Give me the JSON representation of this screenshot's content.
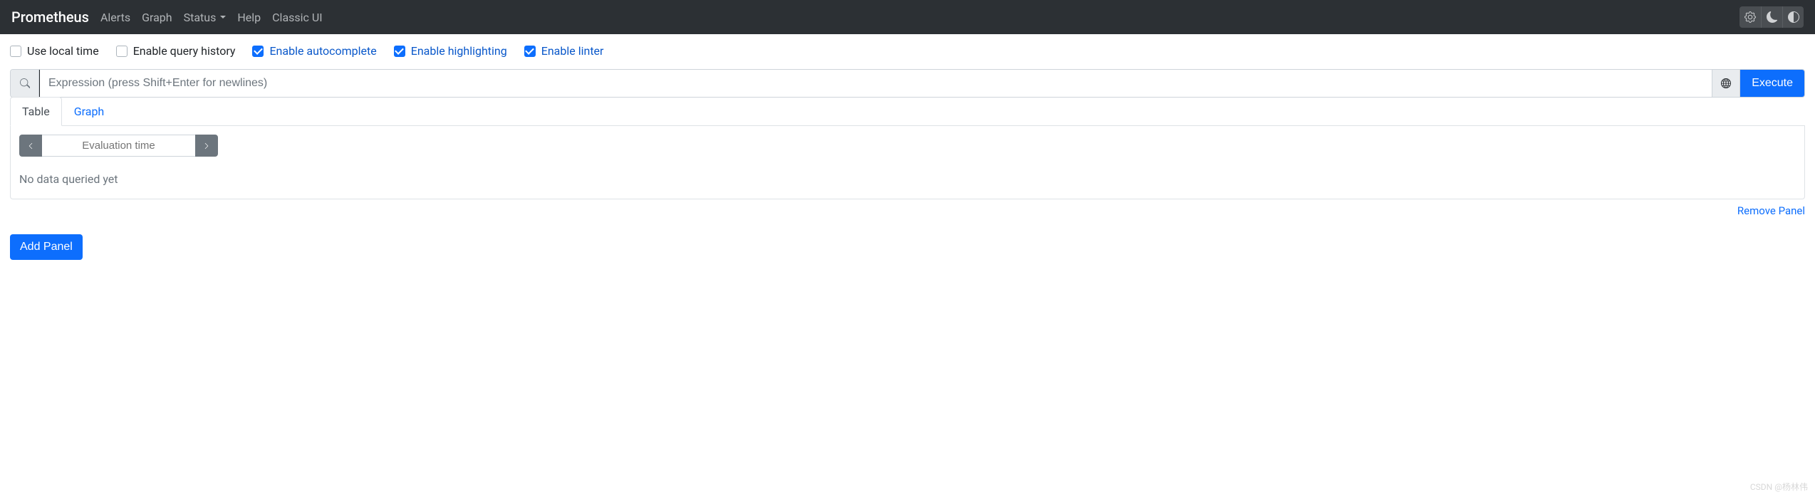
{
  "navbar": {
    "brand": "Prometheus",
    "links": {
      "alerts": "Alerts",
      "graph": "Graph",
      "status": "Status",
      "help": "Help",
      "classic": "Classic UI"
    }
  },
  "options": {
    "local_time": {
      "label": "Use local time",
      "checked": false
    },
    "query_history": {
      "label": "Enable query history",
      "checked": false
    },
    "autocomplete": {
      "label": "Enable autocomplete",
      "checked": true
    },
    "highlighting": {
      "label": "Enable highlighting",
      "checked": true
    },
    "linter": {
      "label": "Enable linter",
      "checked": true
    }
  },
  "query": {
    "value": "",
    "placeholder": "Expression (press Shift+Enter for newlines)",
    "execute_label": "Execute"
  },
  "tabs": {
    "table": "Table",
    "graph": "Graph",
    "active": "table"
  },
  "table_panel": {
    "eval_time_placeholder": "Evaluation time",
    "no_data": "No data queried yet"
  },
  "actions": {
    "remove_panel": "Remove Panel",
    "add_panel": "Add Panel"
  },
  "watermark": "CSDN @杨林伟"
}
